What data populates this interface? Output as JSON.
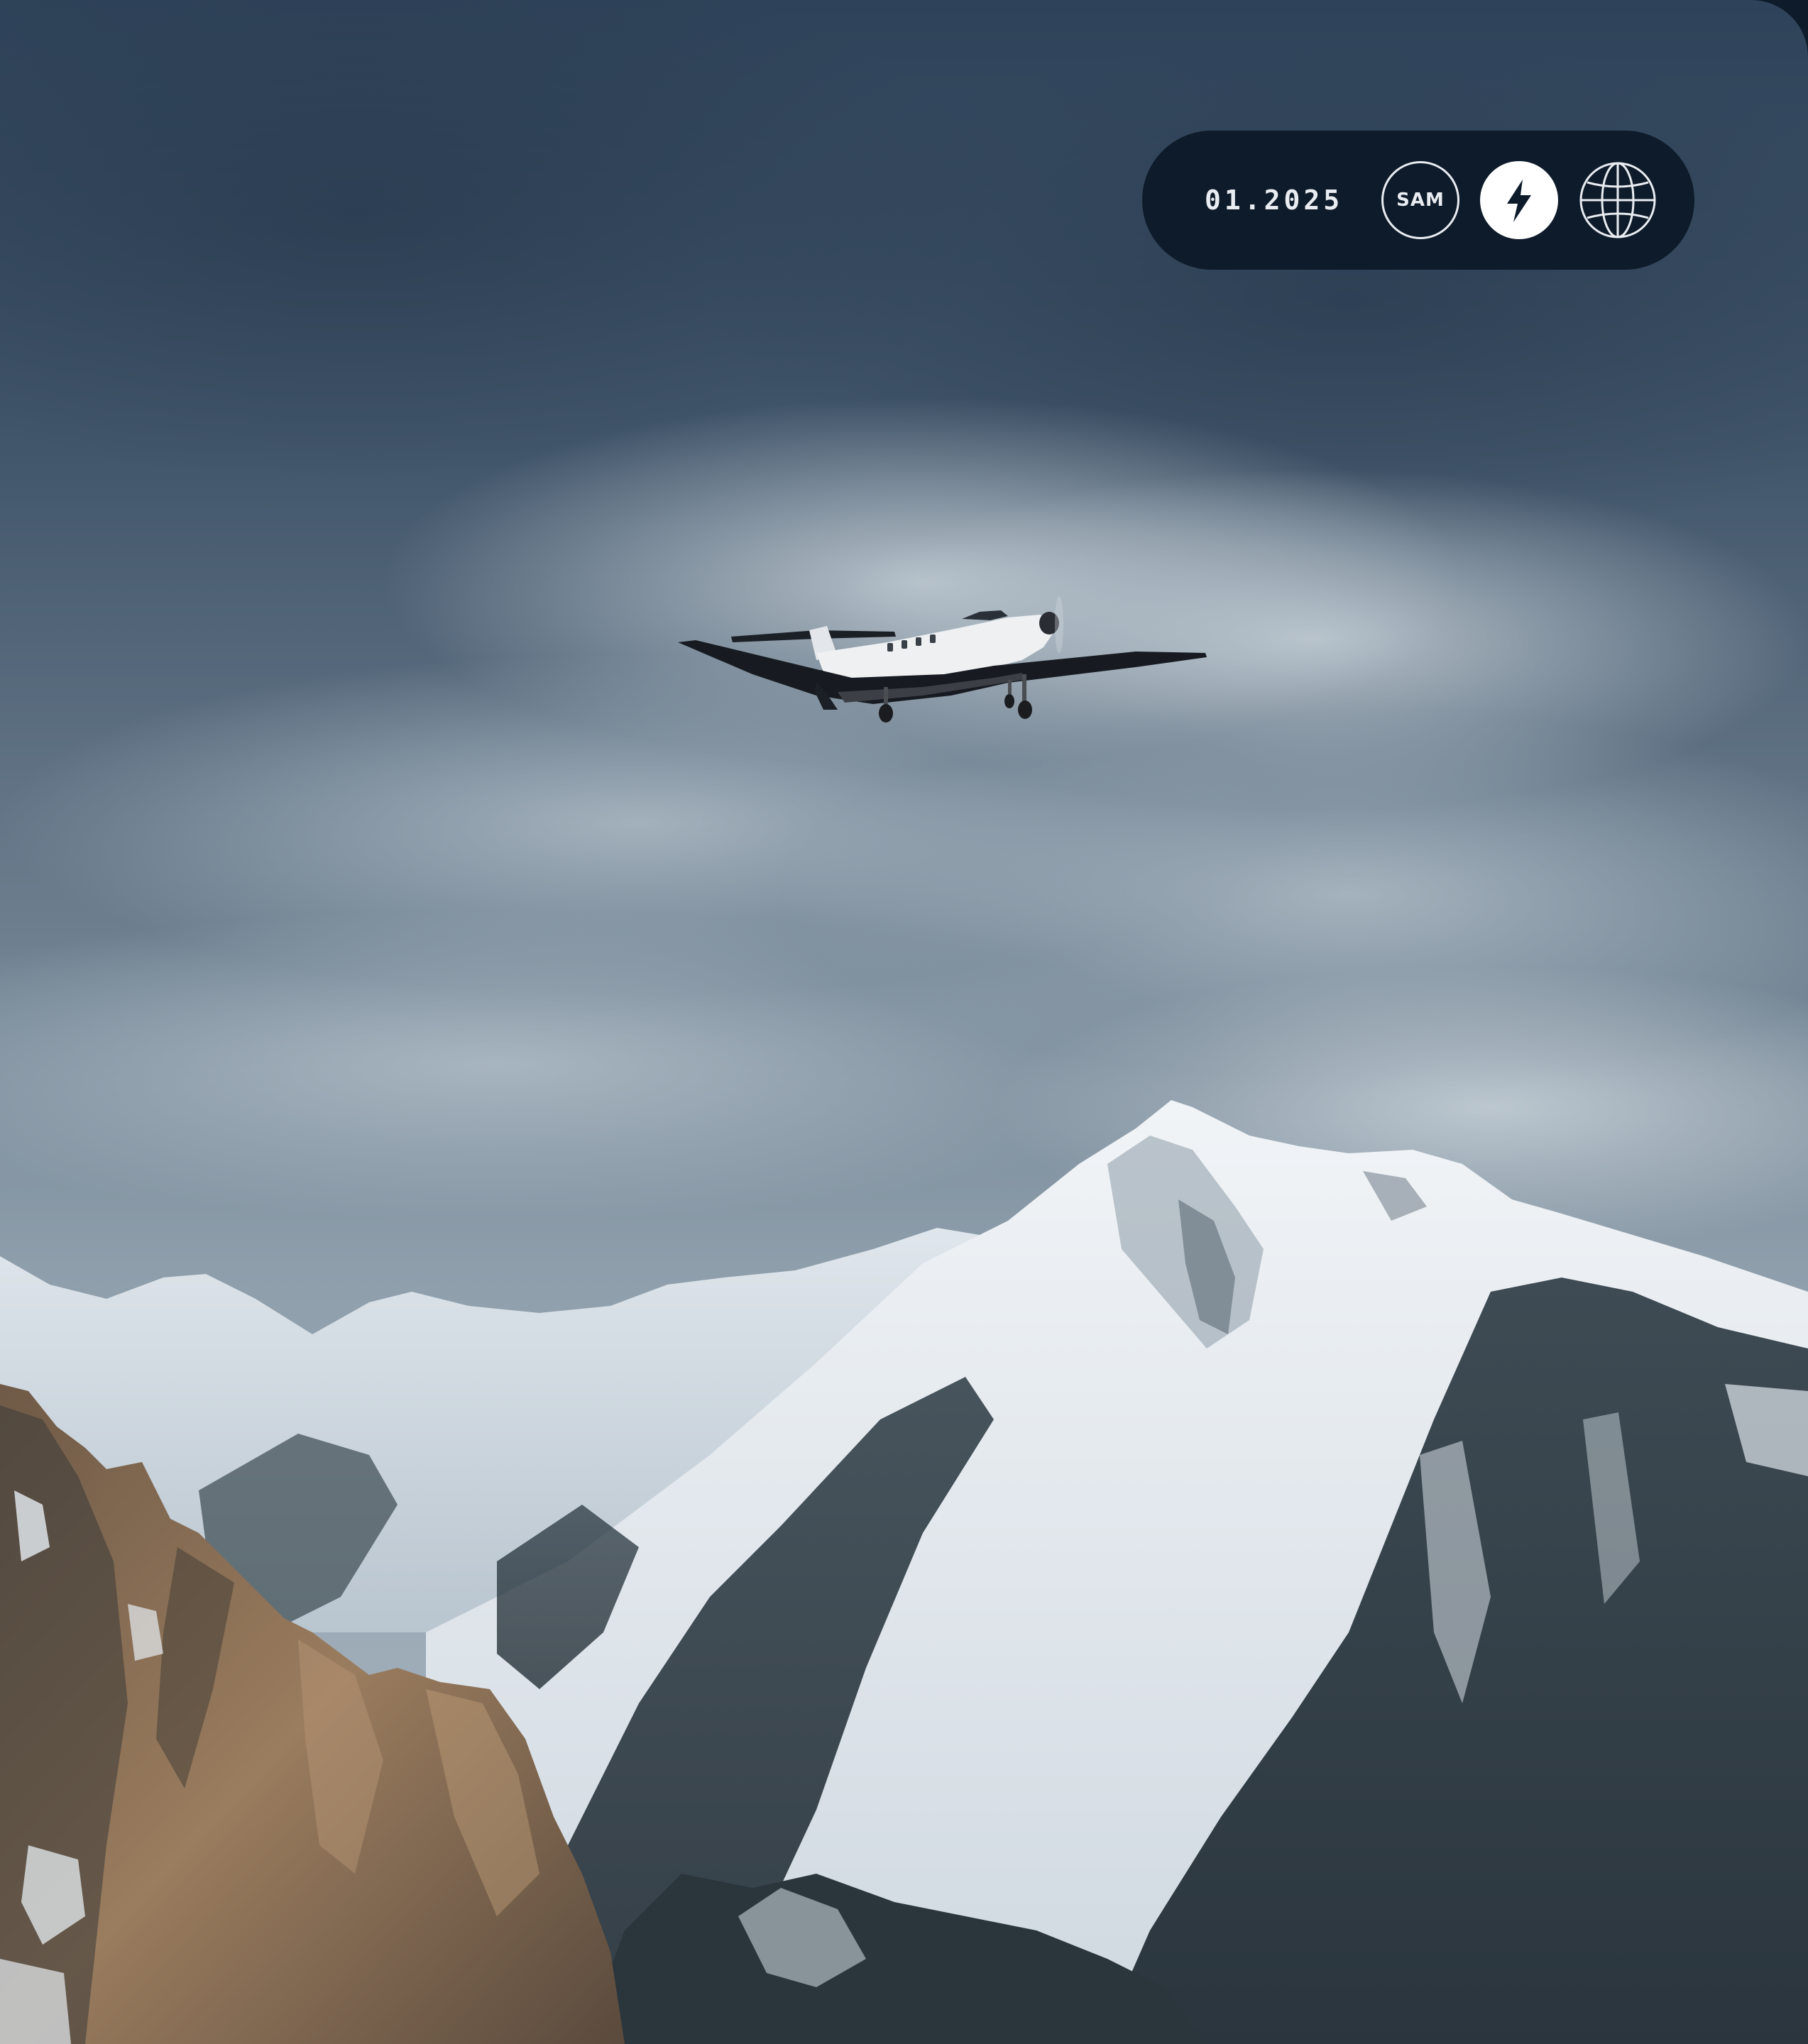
{
  "header_badge": {
    "date": "01.2025",
    "sam_label": "SAM",
    "bolt_icon": "lightning-bolt-icon",
    "globe_icon": "globe-icon"
  },
  "scene": {
    "subject": "turboprop-airplane",
    "background": "snow-capped-mountains-under-cloudy-sky",
    "colors": {
      "sky_top": "#33475e",
      "sky_mid": "#7e8f9d",
      "cloud": "#aebcc6",
      "snow": "#e4eaf0",
      "forest": "#1f2b33",
      "rock": "#8a6e52",
      "badge_bg": "#0e1b2a"
    }
  }
}
